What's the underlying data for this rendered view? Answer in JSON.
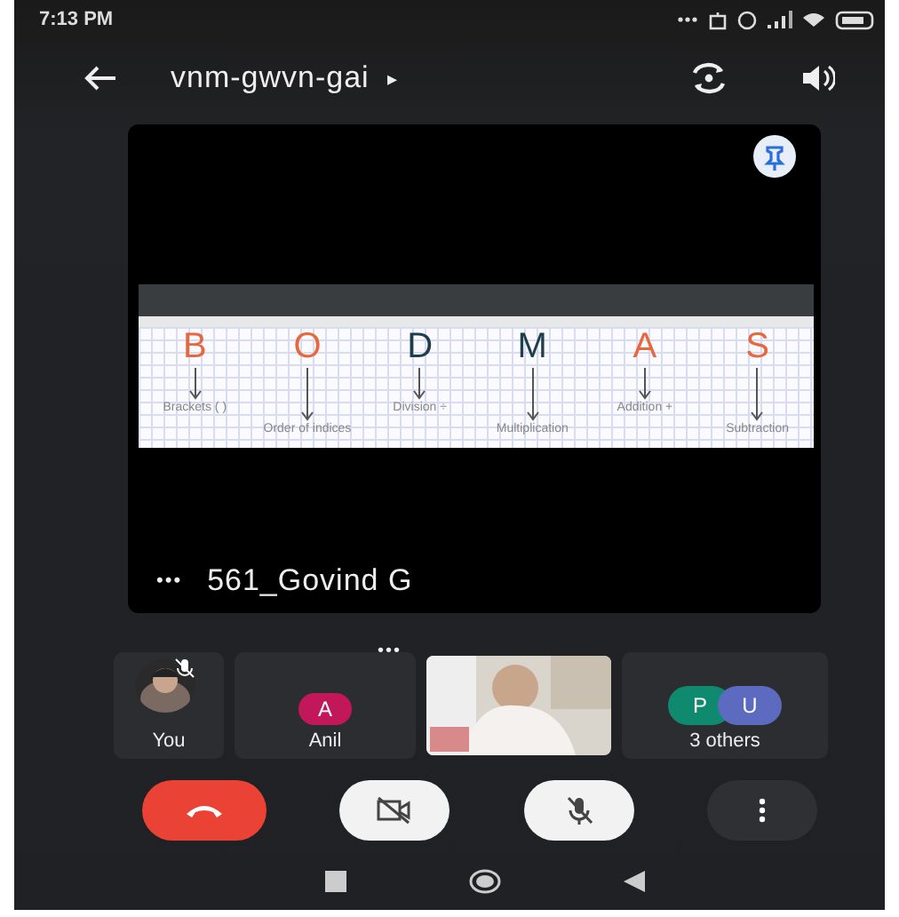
{
  "status_bar": {
    "time": "7:13 PM"
  },
  "header": {
    "meeting_code": "vnm-gwvn-gai",
    "expand_glyph": "▸"
  },
  "main_tile": {
    "menu_glyph": "•••",
    "name": "561_Govind G",
    "pinned": true,
    "slide": {
      "columns": [
        {
          "letter": "B",
          "color": "#e8683e",
          "label": "Brackets ( )"
        },
        {
          "letter": "O",
          "color": "#e8683e",
          "label": "Order of indices"
        },
        {
          "letter": "D",
          "color": "#1d3f4a",
          "label": "Division ÷"
        },
        {
          "letter": "M",
          "color": "#1d3f4a",
          "label": "Multiplication"
        },
        {
          "letter": "A",
          "color": "#e8683e",
          "label": "Addition +"
        },
        {
          "letter": "S",
          "color": "#e8683e",
          "label": "Subtraction"
        }
      ]
    }
  },
  "participants": [
    {
      "kind": "self",
      "label": "You",
      "mic_muted": true
    },
    {
      "kind": "avatar",
      "label": "Anil",
      "initial": "A",
      "color": "#c2185b",
      "menu_glyph": "•••"
    },
    {
      "kind": "video"
    },
    {
      "kind": "group",
      "label": "3 others",
      "avatars": [
        {
          "initial": "P",
          "color": "#0f8a6e"
        },
        {
          "initial": "U",
          "color": "#5c6bc0"
        }
      ]
    }
  ],
  "controls": [
    {
      "kind": "end_call"
    },
    {
      "kind": "camera",
      "on": false
    },
    {
      "kind": "mic",
      "on": false
    },
    {
      "kind": "more"
    }
  ]
}
